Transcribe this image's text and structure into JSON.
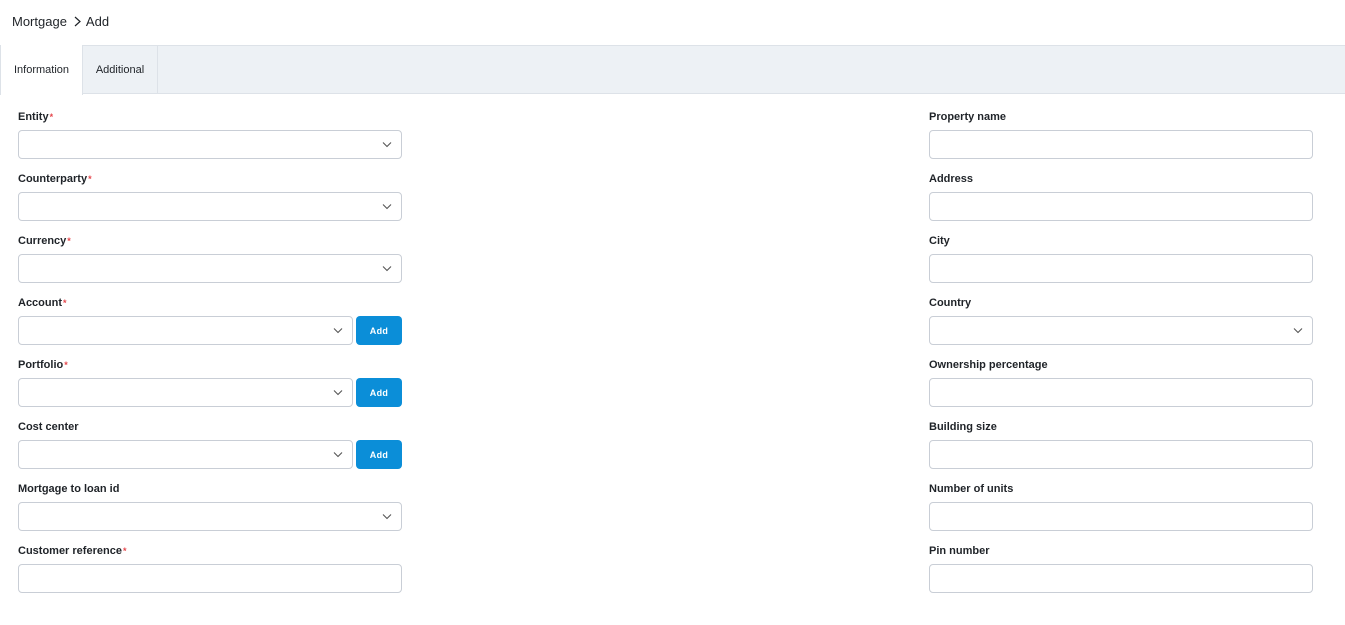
{
  "breadcrumb": {
    "parent": "Mortgage",
    "current": "Add"
  },
  "tabs": [
    {
      "label": "Information",
      "active": true
    },
    {
      "label": "Additional",
      "active": false
    }
  ],
  "left_fields": {
    "entity": {
      "label": "Entity",
      "required_mark": "*",
      "value": ""
    },
    "counterparty": {
      "label": "Counterparty",
      "required_mark": "*",
      "value": ""
    },
    "currency": {
      "label": "Currency",
      "required_mark": "*",
      "value": ""
    },
    "account": {
      "label": "Account",
      "required_mark": "*",
      "value": "",
      "add_label": "Add"
    },
    "portfolio": {
      "label": "Portfolio",
      "required_mark": "*",
      "value": "",
      "add_label": "Add"
    },
    "cost_center": {
      "label": "Cost center",
      "value": "",
      "add_label": "Add"
    },
    "mortgage_to_loan_id": {
      "label": "Mortgage to loan id",
      "value": ""
    },
    "customer_reference": {
      "label": "Customer reference",
      "required_mark": "*",
      "value": ""
    }
  },
  "right_fields": {
    "property_name": {
      "label": "Property name",
      "value": ""
    },
    "address": {
      "label": "Address",
      "value": ""
    },
    "city": {
      "label": "City",
      "value": ""
    },
    "country": {
      "label": "Country",
      "value": ""
    },
    "ownership_percentage": {
      "label": "Ownership percentage",
      "value": ""
    },
    "building_size": {
      "label": "Building size",
      "value": ""
    },
    "number_of_units": {
      "label": "Number of units",
      "value": ""
    },
    "pin_number": {
      "label": "Pin number",
      "value": ""
    }
  },
  "colors": {
    "accent": "#0b8ed8",
    "required": "#e5484d",
    "tabbar_bg": "#edf1f5",
    "border": "#c9ced6"
  },
  "icons": {
    "breadcrumb_separator": "chevron-right-icon",
    "select_arrow": "chevron-down-icon"
  }
}
